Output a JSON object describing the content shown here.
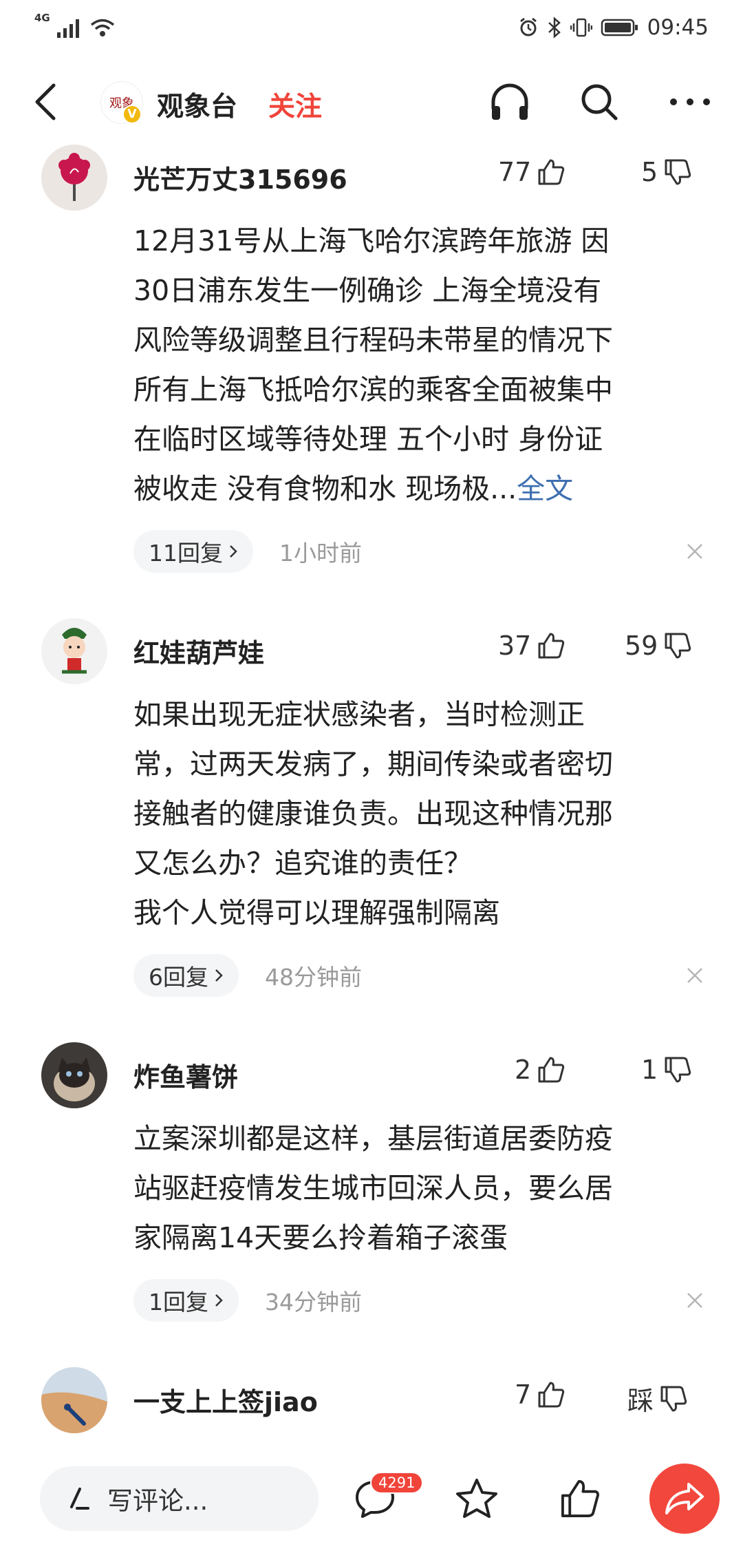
{
  "status_bar": {
    "network": "4G",
    "time": "09:45"
  },
  "header": {
    "channel_name": "观象台",
    "avatar_text": "观象",
    "verified_mark": "V",
    "follow_label": "关注"
  },
  "comments": [
    {
      "username": "光芒万丈315696",
      "likes": "77",
      "dislikes": "5",
      "lines": [
        "12月31号从上海飞哈尔滨跨年旅游 因",
        "30日浦东发生一例确诊 上海全境没有",
        "风险等级调整且行程码未带星的情况下",
        "所有上海飞抵哈尔滨的乘客全面被集中",
        "在临时区域等待处理 五个小时 身份证"
      ],
      "last_line": "被收走 没有食物和水 现场极...",
      "more_label": "全文",
      "replies": "11回复",
      "time": "1小时前"
    },
    {
      "username": "红娃葫芦娃",
      "likes": "37",
      "dislikes": "59",
      "lines": [
        "如果出现无症状感染者，当时检测正",
        "常，过两天发病了，期间传染或者密切",
        "接触者的健康谁负责。出现这种情况那",
        "又怎么办？追究谁的责任？",
        "我个人觉得可以理解强制隔离"
      ],
      "replies": "6回复",
      "time": "48分钟前"
    },
    {
      "username": "炸鱼薯饼",
      "likes": "2",
      "dislikes": "1",
      "lines": [
        "立案深圳都是这样，基层街道居委防疫",
        "站驱赶疫情发生城市回深人员，要么居",
        "家隔离14天要么拎着箱子滚蛋"
      ],
      "replies": "1回复",
      "time": "34分钟前"
    },
    {
      "username": "一支上上签jiao",
      "likes": "7",
      "dislikes": "踩"
    }
  ],
  "bottom_bar": {
    "write_placeholder": "写评论...",
    "comment_count": "4291"
  },
  "colors": {
    "accent_red": "#f0443a",
    "link_blue": "#3e6fb0",
    "share_red": "#f2473c"
  }
}
